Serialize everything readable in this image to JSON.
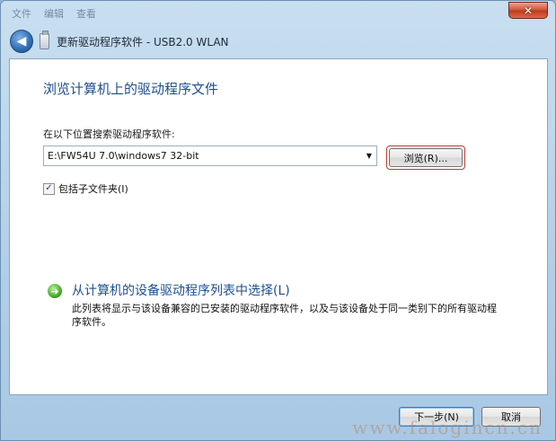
{
  "titlebar": {
    "menu": [
      "文件",
      "编辑",
      "查看"
    ],
    "close_glyph": "✕"
  },
  "nav": {
    "back_glyph": "◀",
    "title": "更新驱动程序软件 - USB2.0 WLAN"
  },
  "page": {
    "heading": "浏览计算机上的驱动程序文件",
    "search_label": "在以下位置搜索驱动程序软件:",
    "path_value": "E:\\FW54U 7.0\\windows7 32-bit",
    "combo_arrow": "▼",
    "browse_label": "浏览(R)...",
    "include_subfolders": {
      "label": "包括子文件夹(I)",
      "checked": true,
      "check_glyph": "✓"
    },
    "pick_option": {
      "arrow_glyph": "➜",
      "title": "从计算机的设备驱动程序列表中选择(L)",
      "description": "此列表将显示与该设备兼容的已安装的驱动程序软件，以及与该设备处于同一类别下的所有驱动程序软件。"
    }
  },
  "footer": {
    "next_label": "下一步(N)",
    "cancel_label": "取消"
  },
  "watermark": "www.falogincn.cn",
  "icons": {
    "back": "back-arrow-icon",
    "device": "usb-device-icon",
    "pick": "green-arrow-icon"
  },
  "colors": {
    "heading_blue": "#1e4f8f",
    "browse_highlight": "#c0392b"
  }
}
